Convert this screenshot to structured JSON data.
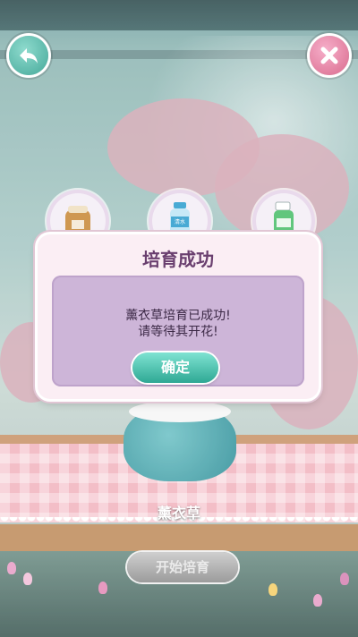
{
  "header": {
    "back_icon": "back-arrow-icon",
    "close_icon": "close-x-icon",
    "accent_back": "#2c9d8c",
    "accent_close": "#d5577e"
  },
  "items": [
    {
      "icon": "sack-icon"
    },
    {
      "icon": "water-bottle-icon",
      "label": "清水"
    },
    {
      "icon": "spray-bottle-icon"
    }
  ],
  "scene": {
    "plant_name": "薰衣草",
    "start_button_label": "开始培育"
  },
  "dialog": {
    "title": "培育成功",
    "message_line1": "薰衣草培育已成功!",
    "message_line2": "请等待其开花!",
    "confirm_label": "确定",
    "confirm_color": "#2ea894"
  }
}
